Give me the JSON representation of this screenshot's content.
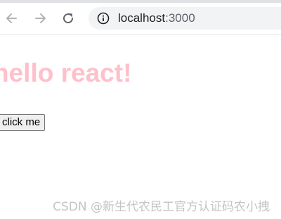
{
  "browser": {
    "address": {
      "host": "localhost",
      "port": ":3000"
    },
    "icons": {
      "back": "back-arrow-icon",
      "forward": "forward-arrow-icon",
      "reload": "reload-icon",
      "info": "info-icon"
    }
  },
  "page": {
    "heading": "hello react!",
    "heading_color": "#ffc0cb",
    "button_label": "click me"
  },
  "watermark": "CSDN @新生代农民工官方认证码农小拽"
}
